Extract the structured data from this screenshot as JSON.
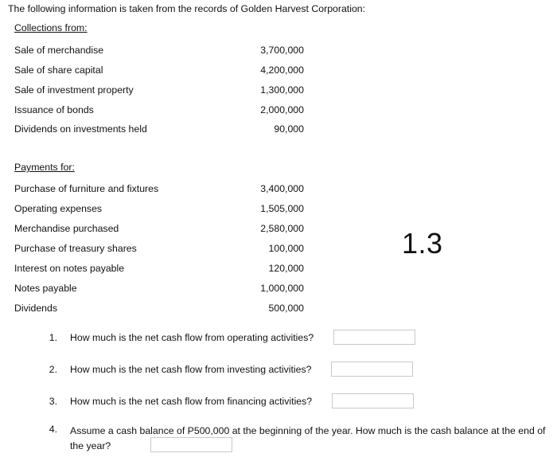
{
  "document": {
    "intro": "The following information is taken from the records of Golden Harvest Corporation:",
    "problem_number": "1.3",
    "sections": [
      {
        "heading": "Collections from:",
        "rows": [
          {
            "label": "Sale of merchandise",
            "amount": "3,700,000"
          },
          {
            "label": "Sale of share capital",
            "amount": "4,200,000"
          },
          {
            "label": "Sale of investment property",
            "amount": "1,300,000"
          },
          {
            "label": "Issuance of bonds",
            "amount": "2,000,000"
          },
          {
            "label": "Dividends on investments held",
            "amount": "90,000"
          }
        ]
      },
      {
        "heading": "Payments for:",
        "rows": [
          {
            "label": "Purchase of furniture and fixtures",
            "amount": "3,400,000"
          },
          {
            "label": "Operating expenses",
            "amount": "1,505,000"
          },
          {
            "label": "Merchandise purchased",
            "amount": "2,580,000"
          },
          {
            "label": "Purchase of treasury shares",
            "amount": "100,000"
          },
          {
            "label": "Interest on notes payable",
            "amount": "120,000"
          },
          {
            "label": "Notes payable",
            "amount": "1,000,000"
          },
          {
            "label": "Dividends",
            "amount": "500,000"
          }
        ]
      }
    ],
    "questions": [
      {
        "num": "1.",
        "text": "How much is the net cash flow from operating activities?",
        "answer": ""
      },
      {
        "num": "2.",
        "text": "How much is the net cash flow from investing activities?",
        "answer": ""
      },
      {
        "num": "3.",
        "text": "How much is the net cash flow from financing activities?",
        "answer": ""
      },
      {
        "num": "4.",
        "text": "Assume a cash balance of P500,000 at the beginning of the year. How much is the cash balance at the end of the year?",
        "answer": ""
      }
    ]
  }
}
